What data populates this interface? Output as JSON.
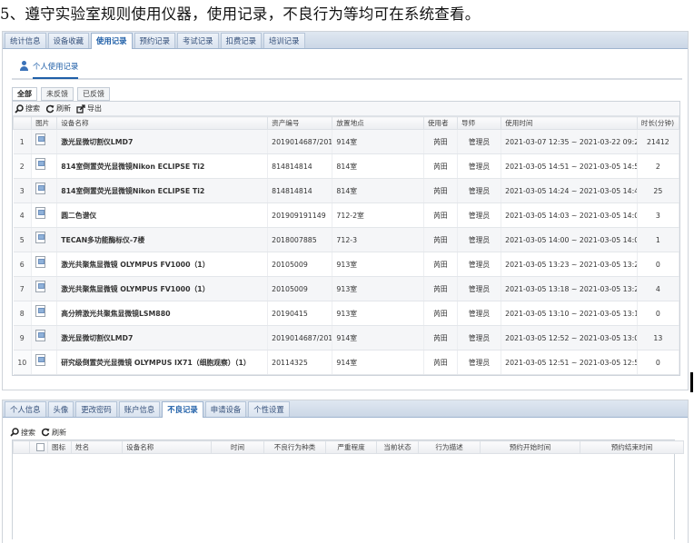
{
  "heading": "5、遵守实验室规则使用仪器，使用记录，不良行为等均可在系统查看。",
  "panel1": {
    "tabs": [
      "统计信息",
      "设备收藏",
      "使用记录",
      "预约记录",
      "考试记录",
      "扣费记录",
      "培训记录"
    ],
    "active_tab": 2,
    "section_title": "个人使用记录",
    "subtabs": [
      "全部",
      "未反馈",
      "已反馈"
    ],
    "toolbar": {
      "search": "搜索",
      "refresh": "刷新",
      "export": "导出"
    },
    "columns": [
      "",
      "图片",
      "设备名称",
      "资产编号",
      "放置地点",
      "使用者",
      "导师",
      "使用时间",
      "时长(分钟)"
    ],
    "rows": [
      {
        "no": "1",
        "name": "激光显微切割仪LMD7",
        "asset": "2019014687/2019",
        "location": "914室",
        "user": "芮田",
        "mentor": "管理员",
        "time": "2021-03-07 12:35 ~ 2021-03-22 09:28",
        "duration": "21412"
      },
      {
        "no": "2",
        "name": "814室倒置荧光显微镜Nikon ECLIPSE Ti2",
        "asset": "814814814",
        "location": "814室",
        "user": "芮田",
        "mentor": "管理员",
        "time": "2021-03-05 14:51 ~ 2021-03-05 14:53",
        "duration": "2"
      },
      {
        "no": "3",
        "name": "814室倒置荧光显微镜Nikon ECLIPSE Ti2",
        "asset": "814814814",
        "location": "814室",
        "user": "芮田",
        "mentor": "管理员",
        "time": "2021-03-05 14:24 ~ 2021-03-05 14:49",
        "duration": "25"
      },
      {
        "no": "4",
        "name": "圆二色谱仪",
        "asset": "201909191149",
        "location": "712-2室",
        "user": "芮田",
        "mentor": "管理员",
        "time": "2021-03-05 14:03 ~ 2021-03-05 14:06",
        "duration": "3"
      },
      {
        "no": "5",
        "name": "TECAN多功能酶标仪-7楼",
        "asset": "2018007885",
        "location": "712-3",
        "user": "芮田",
        "mentor": "管理员",
        "time": "2021-03-05 14:00 ~ 2021-03-05 14:01",
        "duration": "1"
      },
      {
        "no": "6",
        "name": "激光共聚焦显微镜 OLYMPUS FV1000（1）",
        "asset": "20105009",
        "location": "913室",
        "user": "芮田",
        "mentor": "管理员",
        "time": "2021-03-05 13:23 ~ 2021-03-05 13:24",
        "duration": "0"
      },
      {
        "no": "7",
        "name": "激光共聚焦显微镜 OLYMPUS FV1000（1）",
        "asset": "20105009",
        "location": "913室",
        "user": "芮田",
        "mentor": "管理员",
        "time": "2021-03-05 13:18 ~ 2021-03-05 13:22",
        "duration": "4"
      },
      {
        "no": "8",
        "name": "高分辨激光共聚焦显微镜LSM880",
        "asset": "20190415",
        "location": "913室",
        "user": "芮田",
        "mentor": "管理员",
        "time": "2021-03-05 13:10 ~ 2021-03-05 13:10",
        "duration": "0"
      },
      {
        "no": "9",
        "name": "激光显微切割仪LMD7",
        "asset": "2019014687/2019",
        "location": "914室",
        "user": "芮田",
        "mentor": "管理员",
        "time": "2021-03-05 12:52 ~ 2021-03-05 13:06",
        "duration": "13"
      },
      {
        "no": "10",
        "name": "研究级倒置荧光显微镜 OLYMPUS IX71（细胞观察）（1）",
        "asset": "20114325",
        "location": "914室",
        "user": "芮田",
        "mentor": "管理员",
        "time": "2021-03-05 12:51 ~ 2021-03-05 12:52",
        "duration": "0"
      }
    ]
  },
  "panel2": {
    "tabs": [
      "个人信息",
      "头像",
      "更改密码",
      "账户信息",
      "不良记录",
      "申请设备",
      "个性设置"
    ],
    "active_tab": 4,
    "toolbar": {
      "search": "搜索",
      "refresh": "刷新"
    },
    "columns": [
      "",
      "",
      "图标",
      "姓名",
      "设备名称",
      "时间",
      "不良行为种类",
      "严重程度",
      "当前状态",
      "行为描述",
      "预约开始时间",
      "预约结束时间"
    ]
  },
  "colors": {
    "accent": "#1f5fa8",
    "tabbar": "#cbd7e6",
    "row_alt": "#f5f6f8"
  }
}
